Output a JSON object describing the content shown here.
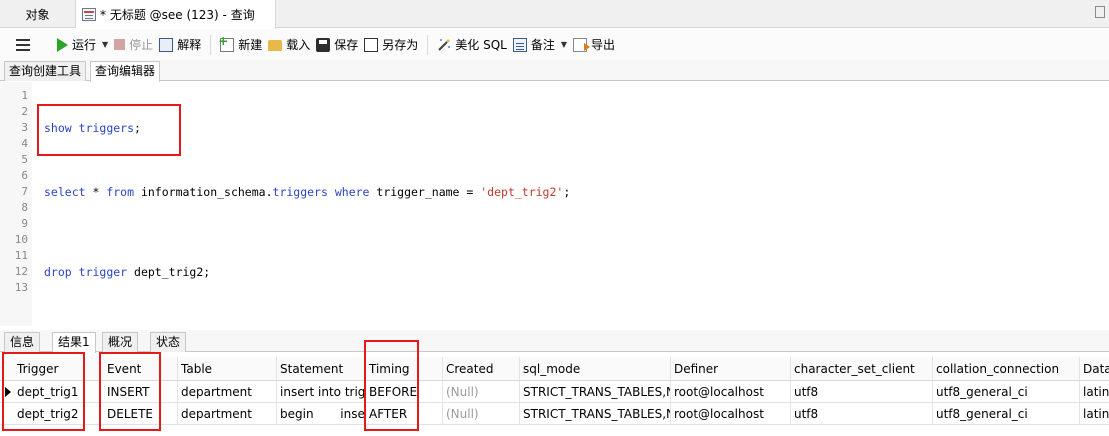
{
  "tabs": {
    "objects_label": "对象",
    "query_tab_label": "* 无标题 @see (123) - 查询"
  },
  "toolbar": {
    "run_label": "运行",
    "stop_label": "停止",
    "explain_label": "解释",
    "new_label": "新建",
    "load_label": "载入",
    "save_label": "保存",
    "saveas_label": "另存为",
    "beautify_label": "美化 SQL",
    "comment_label": "备注",
    "export_label": "导出"
  },
  "subtabs": [
    "查询创建工具",
    "查询编辑器"
  ],
  "editor": {
    "line_numbers": [
      "1",
      "2",
      "3",
      "4",
      "5",
      "6",
      "7",
      "8",
      "9",
      "10",
      "11",
      "12",
      "13"
    ],
    "line3": {
      "kw1": "show",
      "kw2": "triggers",
      "tail": ";"
    },
    "line7": {
      "kw_select": "select",
      "star": " * ",
      "kw_from": "from",
      "schema": " information_schema.",
      "kw_triggers": "triggers",
      "kw_where": "where",
      "col": " trigger_name = ",
      "str": "'dept_trig2'",
      "tail": ";"
    },
    "line12": {
      "kw_drop": "drop",
      "kw_trigger": "trigger",
      "name": " dept_trig2;"
    }
  },
  "result_tabs": [
    "信息",
    "结果1",
    "概况",
    "状态"
  ],
  "grid": {
    "columns": [
      "Trigger",
      "Event",
      "Table",
      "Statement",
      "Timing",
      "Created",
      "sql_mode",
      "Definer",
      "character_set_client",
      "collation_connection",
      "Data"
    ],
    "rows": [
      [
        "dept_trig1",
        "INSERT",
        "department",
        "insert into trigg",
        "BEFORE",
        "(Null)",
        "STRICT_TRANS_TABLES,N",
        "root@localhost",
        "utf8",
        "utf8_general_ci",
        "latin"
      ],
      [
        "dept_trig2",
        "DELETE",
        "department",
        "begin       inser",
        "AFTER",
        "(Null)",
        "STRICT_TRANS_TABLES,N",
        "root@localhost",
        "utf8",
        "utf8_general_ci",
        "latin"
      ]
    ]
  },
  "colors": {
    "keyword": "#2a45c8",
    "string": "#c23a2a",
    "highlight_box": "#e21a1a",
    "run_icon": "#2aa52a"
  }
}
